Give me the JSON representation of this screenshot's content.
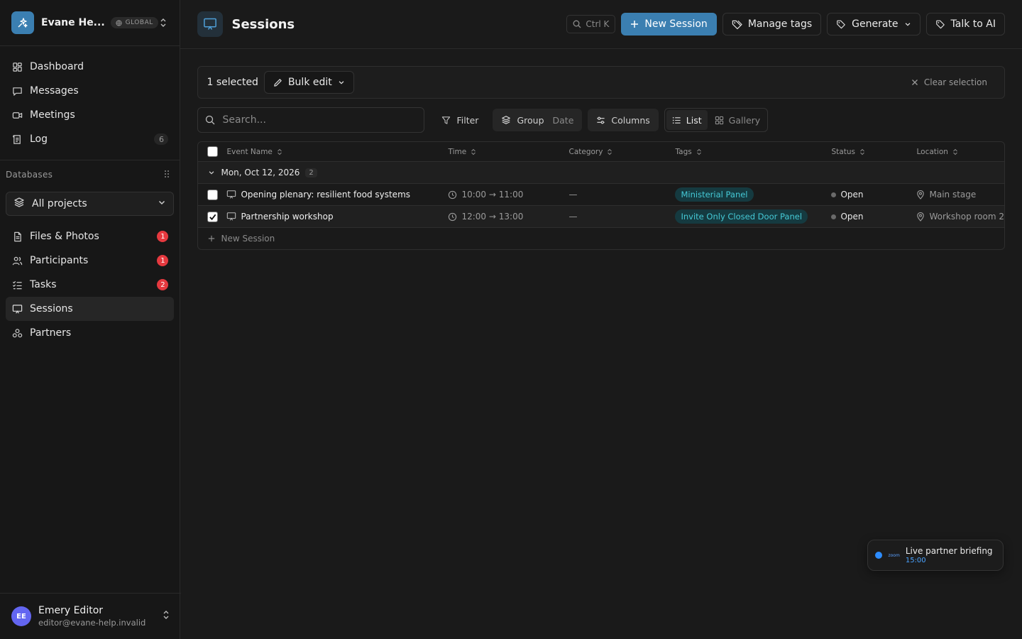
{
  "workspace": {
    "name": "Evane He...",
    "badge": "GLOBAL"
  },
  "nav": [
    {
      "label": "Dashboard",
      "icon": "dashboard-icon"
    },
    {
      "label": "Messages",
      "icon": "message-icon"
    },
    {
      "label": "Meetings",
      "icon": "video-icon"
    },
    {
      "label": "Log",
      "icon": "log-icon",
      "count": "6"
    }
  ],
  "databases": {
    "heading": "Databases",
    "project_select": "All projects",
    "items": [
      {
        "label": "Files & Photos",
        "icon": "file-icon",
        "badge": "1"
      },
      {
        "label": "Participants",
        "icon": "users-icon",
        "badge": "1"
      },
      {
        "label": "Tasks",
        "icon": "tasks-icon",
        "badge": "2"
      },
      {
        "label": "Sessions",
        "icon": "presentation-icon",
        "active": true
      },
      {
        "label": "Partners",
        "icon": "partners-icon"
      }
    ]
  },
  "user": {
    "initials": "EE",
    "name": "Emery Editor",
    "email": "editor@evane-help.invalid"
  },
  "header": {
    "title": "Sessions",
    "shortcut": "Ctrl K",
    "new_session": "New Session",
    "manage_tags": "Manage tags",
    "generate": "Generate",
    "talk_to_ai": "Talk to AI"
  },
  "selection": {
    "count_label": "1 selected",
    "bulk_edit": "Bulk edit",
    "clear": "Clear selection"
  },
  "toolbar": {
    "search_placeholder": "Search...",
    "filter": "Filter",
    "group": "Group",
    "group_value": "Date",
    "columns": "Columns",
    "view_list": "List",
    "view_gallery": "Gallery"
  },
  "table": {
    "columns": [
      "Event Name",
      "Time",
      "Category",
      "Tags",
      "Status",
      "Location"
    ],
    "group": {
      "label": "Mon, Oct 12, 2026",
      "count": "2"
    },
    "rows": [
      {
        "name": "Opening plenary: resilient food systems",
        "time": "10:00 → 11:00",
        "category": "—",
        "tag": "Ministerial Panel",
        "status": "Open",
        "location": "Main stage",
        "checked": false
      },
      {
        "name": "Partnership workshop",
        "time": "12:00 → 13:00",
        "category": "—",
        "tag": "Invite Only Closed Door Panel",
        "status": "Open",
        "location": "Workshop room 2",
        "checked": true
      }
    ],
    "new_row": "New Session"
  },
  "toast": {
    "brand": "zoom",
    "title": "Live partner briefing",
    "time": "15:00"
  }
}
